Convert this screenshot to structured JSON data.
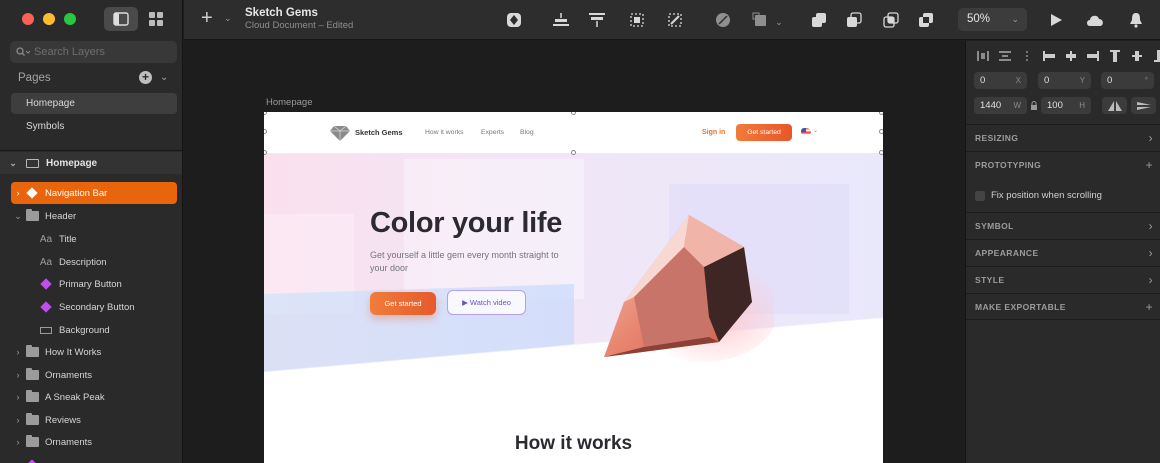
{
  "app": {
    "doc_title": "Sketch Gems",
    "doc_subtitle": "Cloud Document – Edited",
    "zoom": "50%"
  },
  "sidebar": {
    "search_placeholder": "Search Layers",
    "pages_label": "Pages",
    "pages": [
      "Homepage",
      "Symbols"
    ],
    "artboard": "Homepage",
    "layers": [
      {
        "label": "Navigation Bar",
        "icon": "symbol-diamond-icon",
        "selected": true
      },
      {
        "label": "Header",
        "icon": "folder-icon"
      },
      {
        "label": "Title",
        "icon": "text-icon"
      },
      {
        "label": "Description",
        "icon": "text-icon"
      },
      {
        "label": "Primary Button",
        "icon": "symbol-diamond-icon"
      },
      {
        "label": "Secondary Button",
        "icon": "symbol-diamond-icon"
      },
      {
        "label": "Background",
        "icon": "rectangle-icon"
      },
      {
        "label": "How It Works",
        "icon": "folder-icon"
      },
      {
        "label": "Ornaments",
        "icon": "folder-icon"
      },
      {
        "label": "A Sneak Peak",
        "icon": "folder-icon"
      },
      {
        "label": "Reviews",
        "icon": "folder-icon"
      },
      {
        "label": "Ornaments",
        "icon": "folder-icon"
      }
    ]
  },
  "canvas": {
    "artboard_label": "Homepage",
    "nav": {
      "brand": "Sketch Gems",
      "links": [
        "How it works",
        "Experts",
        "Blog"
      ],
      "sign_in": "Sign in",
      "cta": "Get started"
    },
    "hero": {
      "title": "Color your life",
      "description": "Get yourself a little gem every month straight to your door",
      "primary_button": "Get started",
      "secondary_button": "▶ Watch video"
    },
    "section_title": "How it works"
  },
  "inspector": {
    "x": "0",
    "x_label": "X",
    "y": "0",
    "y_label": "Y",
    "rotation": "0",
    "rotation_label": "°",
    "w": "1440",
    "w_label": "W",
    "h": "100",
    "h_label": "H",
    "sections": [
      "RESIZING",
      "PROTOTYPING",
      "SYMBOL",
      "APPEARANCE",
      "STYLE",
      "MAKE EXPORTABLE"
    ],
    "fix_position_label": "Fix position when scrolling"
  },
  "colors": {
    "accent": "#e8650c",
    "symbol": "#c14ef0"
  }
}
